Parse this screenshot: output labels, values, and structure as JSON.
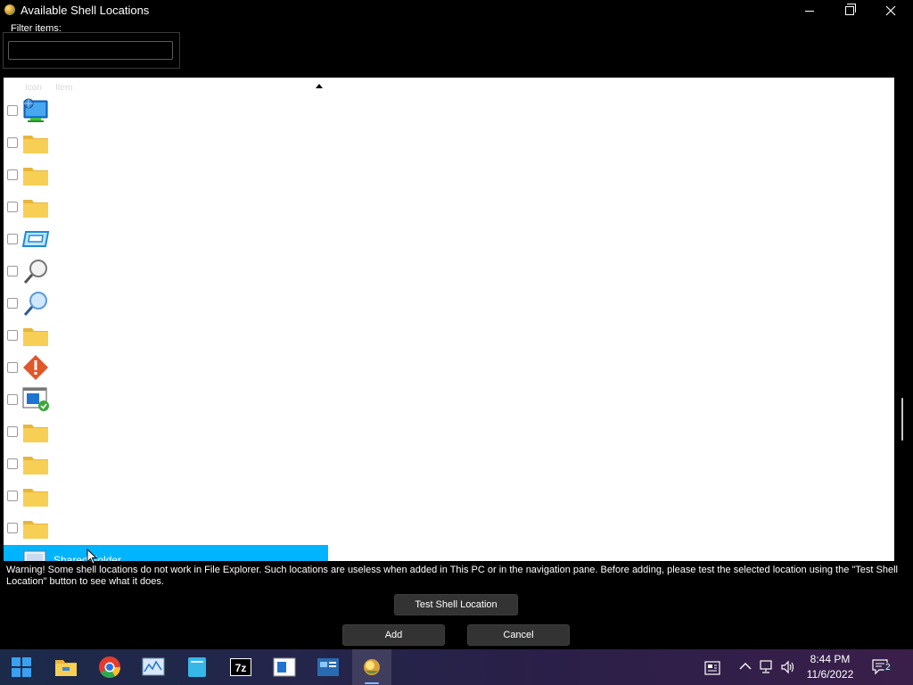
{
  "window": {
    "title": "Available Shell Locations"
  },
  "filter": {
    "label": "Filter items:",
    "value": "",
    "placeholder": ""
  },
  "list": {
    "columns": {
      "icon": "Icon",
      "item": "Item"
    },
    "rows": [
      {
        "icon": "network-globe-icon",
        "checked": false
      },
      {
        "icon": "folder-icon",
        "checked": false
      },
      {
        "icon": "folder-icon",
        "checked": false
      },
      {
        "icon": "folder-icon",
        "checked": false
      },
      {
        "icon": "monitor-frame-icon",
        "checked": false
      },
      {
        "icon": "magnifier-icon",
        "checked": false
      },
      {
        "icon": "magnifier-blue-icon",
        "checked": false
      },
      {
        "icon": "folder-icon",
        "checked": false
      },
      {
        "icon": "warning-diamond-icon",
        "checked": false
      },
      {
        "icon": "window-check-icon",
        "checked": false
      },
      {
        "icon": "folder-icon",
        "checked": false
      },
      {
        "icon": "folder-icon",
        "checked": false
      },
      {
        "icon": "folder-icon",
        "checked": false
      },
      {
        "icon": "folder-icon",
        "checked": false
      }
    ],
    "selected_row": {
      "icon": "shared-folder-icon",
      "text": "Shared Folder"
    }
  },
  "warning": "Warning! Some shell locations do not work in File Explorer. Such locations are useless when added in This PC or in the navigation pane. Before adding, please test the selected location using the \"Test Shell Location\" button to see what it does.",
  "buttons": {
    "test": "Test Shell Location",
    "add": "Add",
    "cancel": "Cancel"
  },
  "taskbar": {
    "apps": [
      "start-icon",
      "file-explorer-icon",
      "chrome-icon",
      "resource-monitor-icon",
      "notepad-icon",
      "7zip-icon",
      "app-window-icon",
      "control-panel-icon",
      "winaero-tweaker-icon"
    ],
    "time": "8:44 PM",
    "date": "11/6/2022",
    "notification_count": "2"
  },
  "colors": {
    "selection": "#00b4ff",
    "folder": "#f5c84a"
  }
}
